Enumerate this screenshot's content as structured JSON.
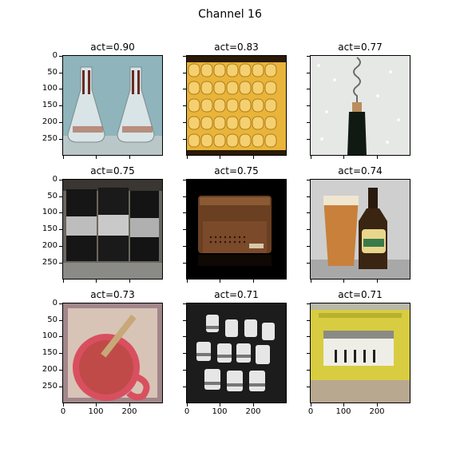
{
  "figure": {
    "title": "Channel 16"
  },
  "panels": [
    {
      "title": "act=0.90",
      "image": "chemistry-flasks"
    },
    {
      "title": "act=0.83",
      "image": "corn-cob"
    },
    {
      "title": "act=0.77",
      "image": "corkscrew-bottle"
    },
    {
      "title": "act=0.75",
      "image": "metal-barrels"
    },
    {
      "title": "act=0.75",
      "image": "leather-wallet"
    },
    {
      "title": "act=0.74",
      "image": "beer-glass-bottle"
    },
    {
      "title": "act=0.73",
      "image": "pink-mug-straw"
    },
    {
      "title": "act=0.71",
      "image": "bw-cylinders"
    },
    {
      "title": "act=0.71",
      "image": "yellow-machine"
    }
  ],
  "axes": {
    "y_ticks": [
      "0",
      "50",
      "100",
      "150",
      "200",
      "250"
    ],
    "y_values": [
      0,
      50,
      100,
      150,
      200,
      250
    ],
    "x_ticks": [
      "0",
      "100",
      "200"
    ],
    "x_values": [
      0,
      100,
      200
    ],
    "extent": [
      0,
      299
    ]
  }
}
